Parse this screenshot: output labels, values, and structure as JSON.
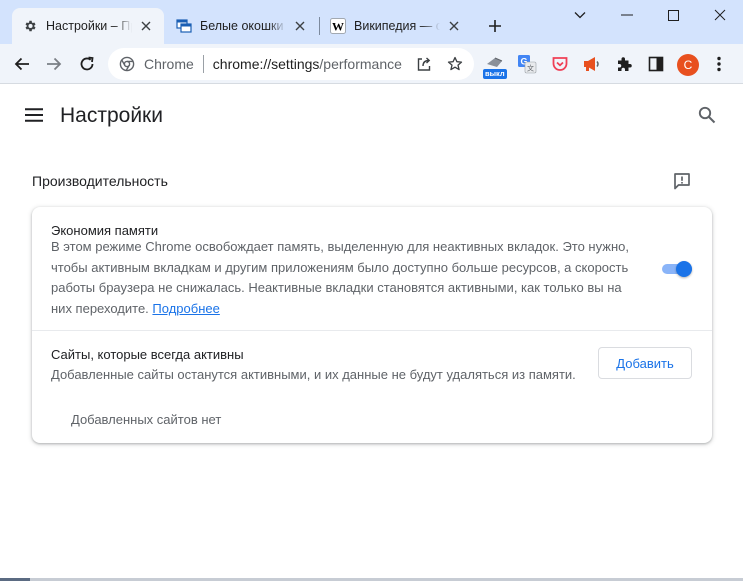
{
  "tabs": [
    {
      "title": "Настройки – Произв",
      "icon": "gear-icon",
      "active": true
    },
    {
      "title": "Белые окошки на сайте",
      "icon": "windows-icon",
      "active": false
    },
    {
      "title": "Википедия — свободная",
      "icon": "wikipedia-icon",
      "active": false
    }
  ],
  "omnibox": {
    "chip": "Chrome",
    "url_host": "chrome://settings",
    "url_path": "/performance"
  },
  "extensions": {
    "badge_text": "выкл",
    "avatar_letter": "C"
  },
  "settings": {
    "page_title": "Настройки",
    "section_title": "Производительность",
    "memory_saver": {
      "title": "Экономия памяти",
      "description": "В этом режиме Chrome освобождает память, выделенную для неактивных вкладок. Это нужно, чтобы активным вкладкам и другим приложениям было доступно больше ресурсов, а скорость работы браузера не снижалась. Неактивные вкладки становятся активными, как только вы на них переходите.",
      "learn_more": "Подробнее",
      "enabled": true
    },
    "always_active": {
      "title": "Сайты, которые всегда активны",
      "description": "Добавленные сайты останутся активными, и их данные не будут удаляться из памяти.",
      "add_label": "Добавить",
      "empty_text": "Добавленных сайтов нет"
    }
  },
  "colors": {
    "accent": "#1a73e8",
    "tabstrip": "#d3e3fd",
    "toolbar": "#f0f4fa",
    "avatar": "#e8501f"
  }
}
